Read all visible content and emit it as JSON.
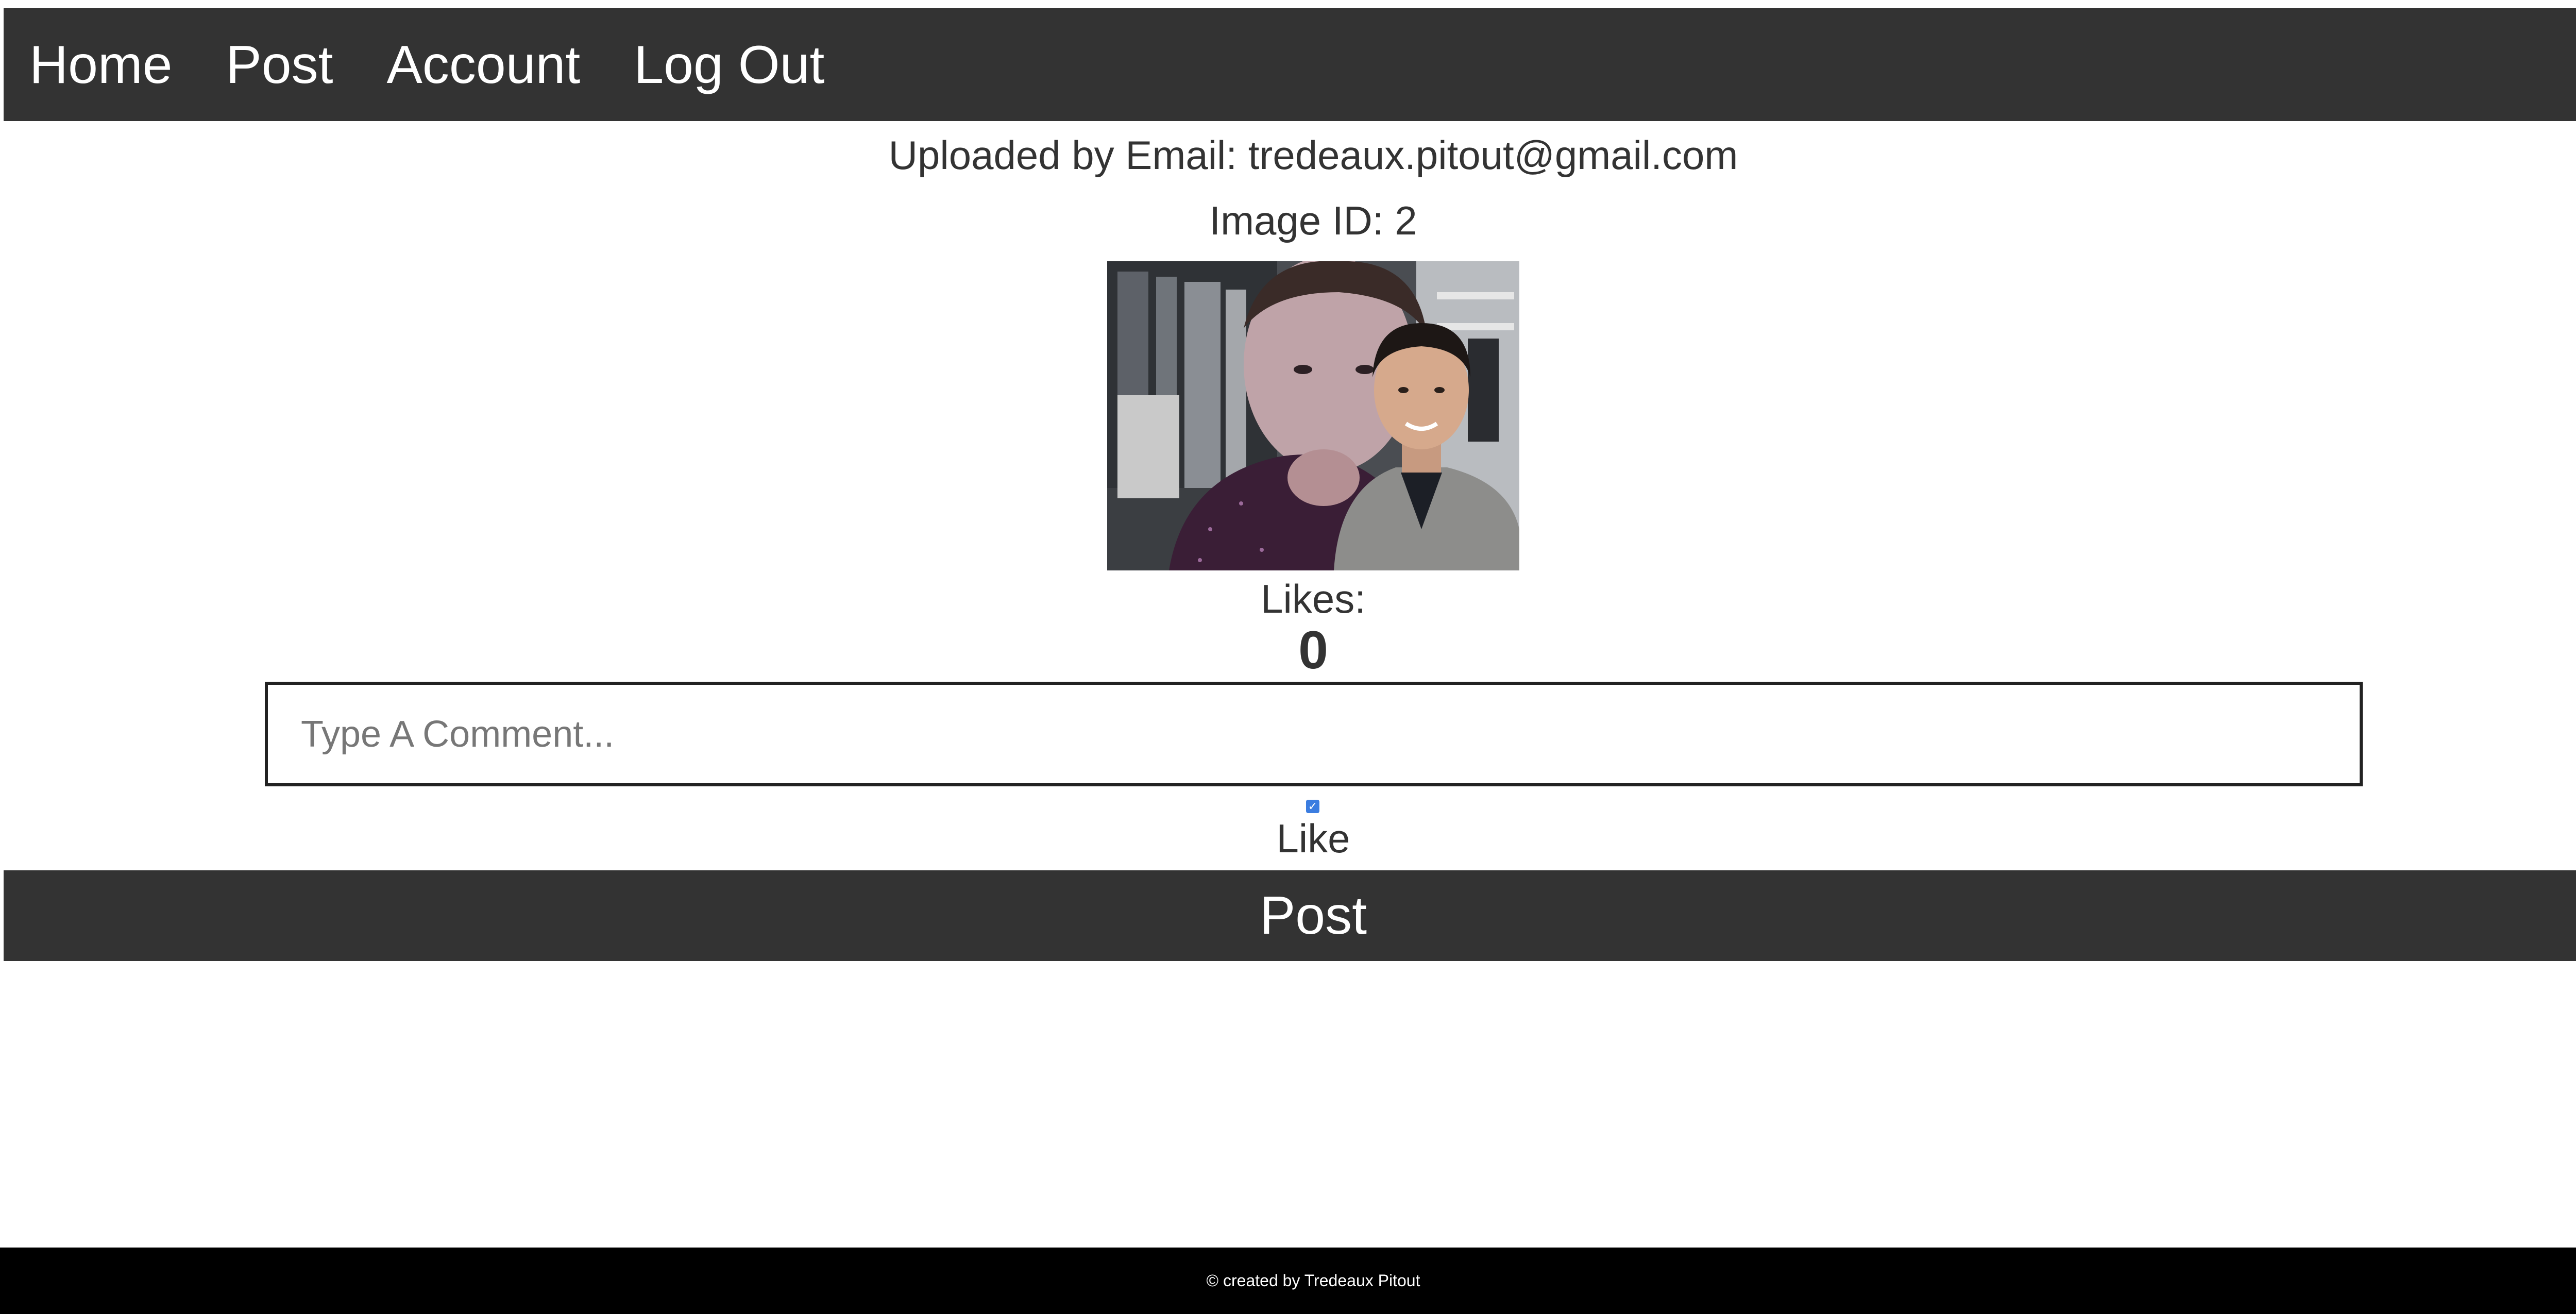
{
  "nav": {
    "items": [
      {
        "label": "Home"
      },
      {
        "label": "Post"
      },
      {
        "label": "Account"
      },
      {
        "label": "Log Out"
      }
    ]
  },
  "post": {
    "uploader_text": "Uploaded by Email: tredeaux.pitout@gmail.com",
    "image_id_text": "Image ID: 2",
    "likes_label": "Likes:",
    "likes_count": "0"
  },
  "comment": {
    "placeholder": "Type A Comment...",
    "value": ""
  },
  "like": {
    "label": "Like",
    "checked": true
  },
  "post_button": {
    "label": "Post"
  },
  "footer": {
    "text": "© created by Tredeaux Pitout"
  },
  "colors": {
    "nav_bg": "#333333",
    "footer_bg": "#000000",
    "text": "#333333",
    "checkbox_accent": "#3b7de0"
  }
}
